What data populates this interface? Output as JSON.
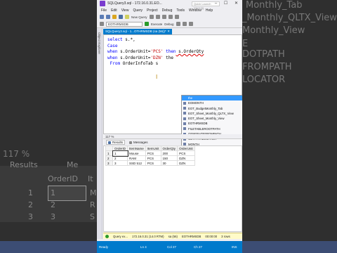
{
  "background": {
    "ghost_texts": [
      "Monthly_Tab",
      "_Monthly_QLTX_View",
      "Monthly_View",
      "E",
      "DOTPATH",
      "FROMPATH",
      "LOCATOR"
    ],
    "ghost_zoom": "117 %",
    "ghost_tab_results": "Results",
    "ghost_tab_messages": "Me",
    "ghost_header": "OrderID",
    "ghost_header2": "It",
    "ghost_rows": [
      "1",
      "2",
      "3"
    ],
    "ghost_vals": [
      "1",
      "2",
      "3"
    ],
    "ghost_vals2": [
      "M",
      "R",
      "S"
    ]
  },
  "window": {
    "title": "SQLQuery3.sql - 172.16.0.31.EO...",
    "quick_launch": "Quick Launch (Ctrl+Q)",
    "controls": "– ☐ ✕"
  },
  "menu": [
    "File",
    "Edit",
    "View",
    "Query",
    "Project",
    "Debug",
    "Tools",
    "Window",
    "Help"
  ],
  "toolbar": {
    "new_query": "New Query",
    "database": "EOTHRMSDB",
    "execute": "Execute",
    "debug": "Debug"
  },
  "sidebar_label": "Object Explorer",
  "editor_tab": {
    "label": "SQLQuery3.sql - 1...OTHRMSDB (sa (56))*",
    "close": "✕"
  },
  "code": {
    "line1_kw": "select",
    "line1_rest": " s.*,",
    "line2": "Case",
    "line3_kw": "when",
    "line3_a": " s.OrderUnit=",
    "line3_str": "'PCS'",
    "line3_then": " then",
    "line3_b": " s.OrderQty",
    "line4_kw": "when",
    "line4_a": " s.OrderUnit=",
    "line4_str": "'DZN'",
    "line4_then": " the",
    "line5_kw": "From",
    "line5_rest": " OrderInfoTab s"
  },
  "intellisense": [
    "the",
    "EOMONTH",
    "EOT_BudgetMonthly_Tab",
    "EOT_Sheet_Monthly_QLTX_View",
    "EOT_Sheet_Monthly_View",
    "EOTHRMSDB",
    "FILETABLEROOTPATH",
    "GENERATEFROMPATH",
    "GETPATHLOCATOR",
    "MONTH"
  ],
  "zoom": "117 %",
  "results_tabs": [
    "Results",
    "Messages"
  ],
  "results": {
    "columns": [
      "OrderID",
      "ItemName",
      "ItemUnit",
      "OrderQty",
      "OrderUnit"
    ],
    "rows": [
      [
        "1",
        "1",
        "Mouse",
        "PCS",
        "200",
        "PCS"
      ],
      [
        "2",
        "2",
        "RAM",
        "PCS",
        "150",
        "DZN"
      ],
      [
        "3",
        "3",
        "SSD 512",
        "PCS",
        "30",
        "DZN"
      ]
    ]
  },
  "query_status": {
    "text": "Query ex...",
    "server": "172.16.0.31 (14.0 RTM)",
    "user": "sa (56)",
    "db": "EOTHRMSDB",
    "time": "00:00:00",
    "rows": "3 rows"
  },
  "statusbar": {
    "ready": "Ready",
    "ln": "Ln 4",
    "col": "Col 27",
    "ch": "Ch 27",
    "ins": "INS"
  },
  "colors": {
    "accent": "#007acc",
    "status_yellow": "#fffbc8",
    "keyword": "#0000ff",
    "string": "#c20000"
  }
}
